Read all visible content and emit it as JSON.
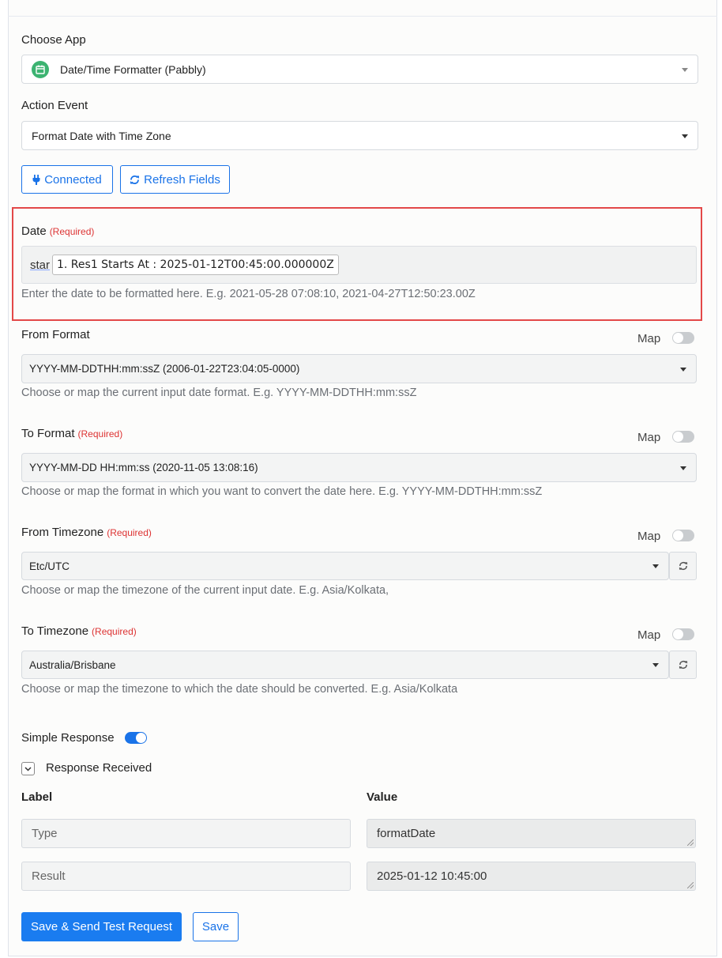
{
  "choose_app": {
    "label": "Choose App",
    "value": "Date/Time Formatter (Pabbly)",
    "icon": "calendar-icon",
    "icon_color": "#3cb371"
  },
  "action_event": {
    "label": "Action Event",
    "value": "Format Date with Time Zone"
  },
  "buttons": {
    "connected": "Connected",
    "refresh_fields": "Refresh Fields"
  },
  "date_field": {
    "label": "Date",
    "required": "(Required)",
    "prefix_text": "star",
    "pill_text": "1. Res1 Starts At : 2025-01-12T00:45:00.000000Z",
    "hint": "Enter the date to be formatted here. E.g. 2021-05-28 07:08:10, 2021-04-27T12:50:23.00Z"
  },
  "from_format": {
    "label": "From Format",
    "map_label": "Map",
    "value": "YYYY-MM-DDTHH:mm:ssZ (2006-01-22T23:04:05-0000)",
    "hint": "Choose or map the current input date format. E.g. YYYY-MM-DDTHH:mm:ssZ"
  },
  "to_format": {
    "label": "To Format",
    "required": "(Required)",
    "map_label": "Map",
    "value": "YYYY-MM-DD HH:mm:ss (2020-11-05 13:08:16)",
    "hint": "Choose or map the format in which you want to convert the date here. E.g. YYYY-MM-DDTHH:mm:ssZ"
  },
  "from_timezone": {
    "label": "From Timezone",
    "required": "(Required)",
    "map_label": "Map",
    "value": "Etc/UTC",
    "hint": "Choose or map the timezone of the current input date. E.g. Asia/Kolkata,"
  },
  "to_timezone": {
    "label": "To Timezone",
    "required": "(Required)",
    "map_label": "Map",
    "value": "Australia/Brisbane",
    "hint": "Choose or map the timezone to which the date should be converted. E.g. Asia/Kolkata"
  },
  "simple_response": {
    "label": "Simple Response",
    "enabled": true
  },
  "response_received": {
    "label": "Response Received",
    "columns": {
      "label": "Label",
      "value": "Value"
    },
    "rows": [
      {
        "label": "Type",
        "value": "formatDate"
      },
      {
        "label": "Result",
        "value": "2025-01-12 10:45:00"
      }
    ]
  },
  "footer": {
    "save_test": "Save & Send Test Request",
    "save": "Save"
  },
  "colors": {
    "accent": "#1a73e8",
    "primary_button": "#1a7cf0",
    "required": "#dd3333",
    "highlight_border": "#e34848"
  }
}
